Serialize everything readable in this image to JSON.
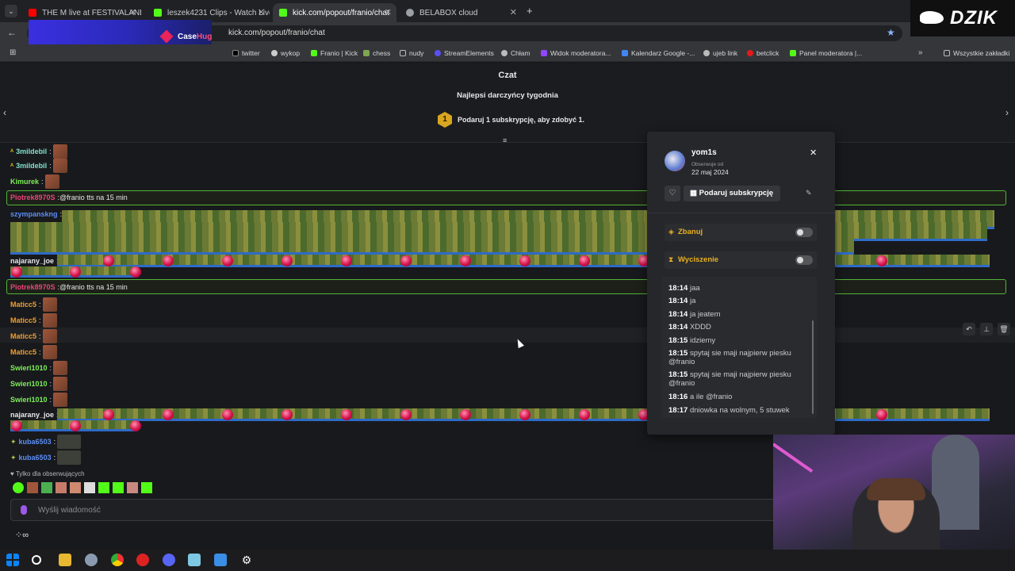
{
  "tabs": [
    {
      "label": "THE M live at FESTIVALAND 2",
      "color": "#ff0000",
      "active": false
    },
    {
      "label": "leszek4231 Clips - Watch Live o",
      "color": "#53fc18",
      "active": false
    },
    {
      "label": "kick.com/popout/franio/chat",
      "color": "#53fc18",
      "active": true
    },
    {
      "label": "BELABOX cloud",
      "color": "#9aa0a6",
      "active": false
    }
  ],
  "url": "kick.com/popout/franio/chat",
  "overlay_brand": {
    "prefix": "Case",
    "suffix": "Hug"
  },
  "stream_logo": "DZIK",
  "bookmarks": [
    "twitter",
    "wykop",
    "Franio | Kick",
    "chess",
    "nudy",
    "StreamElements",
    "Chłam",
    "Widok moderatora...",
    "Kalendarz Google -...",
    "ujeb link",
    "betclick",
    "Panel moderatora |..."
  ],
  "bookmarks_all": "Wszystkie zakładki",
  "chat": {
    "title": "Czat",
    "top_gifters_title": "Najlepsi darczyńcy tygodnia",
    "gift_prompt": "Podaruj 1 subskrypcję, aby zdobyć 1.",
    "gift_rank": "1",
    "followers_only": "Tylko dla obserwujących",
    "input_placeholder": "Wyślij wiadomość"
  },
  "messages": [
    {
      "user": "3mildebil",
      "color": "#7fe3d0",
      "text": ""
    },
    {
      "user": "3mildebil",
      "color": "#7fe3d0",
      "text": ""
    },
    {
      "user": "Kimurek",
      "color": "#7ef15a",
      "text": ""
    },
    {
      "user": "Piotrek8970S",
      "color": "#e8457a",
      "text": "@franio tts na 15 min"
    },
    {
      "user": "szympanskng",
      "color": "#5b8ef5",
      "text": ""
    },
    {
      "user": "najarany_joe",
      "color": "#e8e8ea",
      "text": ""
    },
    {
      "user": "Piotrek8970S",
      "color": "#e8457a",
      "text": "@franio tts na 15 min"
    },
    {
      "user": "Maticc5",
      "color": "#f0a030",
      "text": ""
    },
    {
      "user": "Maticc5",
      "color": "#f0a030",
      "text": ""
    },
    {
      "user": "Maticc5",
      "color": "#f0a030",
      "text": ""
    },
    {
      "user": "Maticc5",
      "color": "#f0a030",
      "text": ""
    },
    {
      "user": "Swieri1010",
      "color": "#7ef15a",
      "text": ""
    },
    {
      "user": "Swieri1010",
      "color": "#7ef15a",
      "text": ""
    },
    {
      "user": "Swieri1010",
      "color": "#7ef15a",
      "text": ""
    },
    {
      "user": "najarany_joe",
      "color": "#e8e8ea",
      "text": ""
    },
    {
      "user": "kuba6503",
      "color": "#5b8ef5",
      "text": ""
    },
    {
      "user": "kuba6503",
      "color": "#5b8ef5",
      "text": ""
    }
  ],
  "mod_popup": {
    "username": "yom1s",
    "follow_label": "Obserwuje od",
    "follow_date": "22 maj 2024",
    "gift_button": "Podaruj subskrypcję",
    "ban_label": "Zbanuj",
    "timeout_label": "Wyciszenie",
    "log": [
      {
        "time": "18:14",
        "text": "jaa"
      },
      {
        "time": "18:14",
        "text": "ja"
      },
      {
        "time": "18:14",
        "text": "ja jeatem"
      },
      {
        "time": "18:14",
        "text": "XDDD"
      },
      {
        "time": "18:15",
        "text": "idziemy"
      },
      {
        "time": "18:15",
        "text": "spytaj sie maji najpierw piesku @franio"
      },
      {
        "time": "18:15",
        "text": "spytaj sie maji najpierw piesku @franio"
      },
      {
        "time": "18:16",
        "text": "a ile @franio"
      },
      {
        "time": "18:17",
        "text": "dniowka na wolnym, 5 stuwek"
      }
    ]
  }
}
